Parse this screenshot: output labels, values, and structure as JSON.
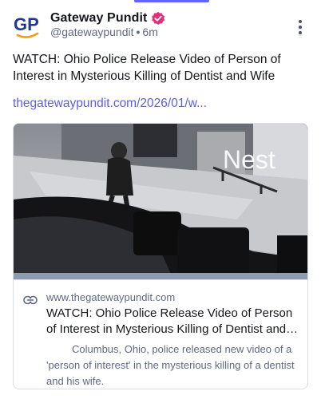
{
  "post": {
    "author": {
      "display_name": "Gateway Pundit",
      "handle": "@gatewaypundit",
      "time": "6m",
      "avatar_text": "GP",
      "avatar_color": "#1f3a8f",
      "avatar_accent": "#f29a1f",
      "verified_color": "#e0307a"
    },
    "text": "WATCH: Ohio Police Release Video of Person of Interest in Mysterious Killing of Dentist and Wife",
    "link_text": "thegatewaypundit.com/2026/01/w...",
    "more_icon": "more-vertical-icon"
  },
  "card": {
    "image_watermark": "Nest",
    "domain": "www.thegatewaypundit.com",
    "title": "WATCH: Ohio Police Release Video of Person of Interest in Mysterious Killing of Dentist and Wife",
    "description": "Columbus, Ohio, police released new video of a 'person of interest' in the mysterious killing of a dentist and his wife.",
    "link_icon": "link-icon"
  },
  "colors": {
    "accent": "#6364ff",
    "link": "#5c5fe0",
    "muted": "#606984"
  }
}
